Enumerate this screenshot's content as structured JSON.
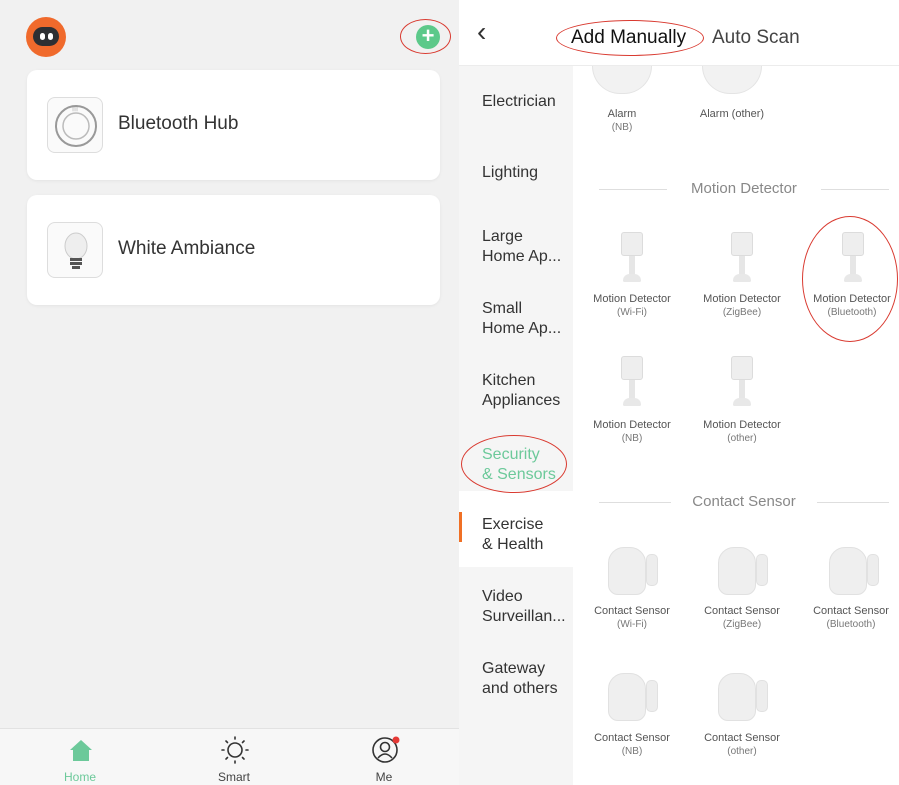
{
  "left_phone": {
    "devices": [
      {
        "label": "Bluetooth Hub",
        "icon": "bluetooth-hub-icon"
      },
      {
        "label": "White Ambiance",
        "icon": "light-bulb-icon"
      }
    ],
    "tabs": [
      {
        "label": "Home",
        "icon": "home-icon",
        "color": "#6cc99a"
      },
      {
        "label": "Smart",
        "icon": "sun-icon",
        "color": "#444444"
      },
      {
        "label": "Me",
        "icon": "user-icon",
        "color": "#444444"
      }
    ]
  },
  "right_phone": {
    "header": {
      "add_manually": "Add Manually",
      "auto_scan": "Auto Scan"
    },
    "categories": [
      "Electrician",
      "Lighting",
      "Large\nHome Ap...",
      "Small\nHome Ap...",
      "Kitchen\nAppliances",
      "Security\n& Sensors",
      "Exercise\n& Health",
      "Video\nSurveillan...",
      "Gateway\nand others"
    ],
    "selected_category_index": 5,
    "alarms": [
      {
        "name": "Alarm",
        "sub": "(NB)"
      },
      {
        "name": "Alarm (other)",
        "sub": ""
      }
    ],
    "motion_section_title": "Motion Detector",
    "motion_items": [
      {
        "name": "Motion Detector",
        "sub": "(Wi-Fi)"
      },
      {
        "name": "Motion Detector",
        "sub": "(ZigBee)"
      },
      {
        "name": "Motion Detector",
        "sub": "(Bluetooth)"
      },
      {
        "name": "Motion Detector",
        "sub": "(NB)"
      },
      {
        "name": "Motion Detector",
        "sub": "(other)"
      }
    ],
    "contact_section_title": "Contact Sensor",
    "contact_items": [
      {
        "name": "Contact Sensor",
        "sub": "(Wi-Fi)"
      },
      {
        "name": "Contact Sensor",
        "sub": "(ZigBee)"
      },
      {
        "name": "Contact Sensor",
        "sub": "(Bluetooth)"
      },
      {
        "name": "Contact Sensor",
        "sub": "(NB)"
      },
      {
        "name": "Contact Sensor",
        "sub": "(other)"
      }
    ]
  },
  "colors": {
    "accent": "#6cc99a",
    "annotation": "#d93a30",
    "selected_bar": "#f07025"
  }
}
